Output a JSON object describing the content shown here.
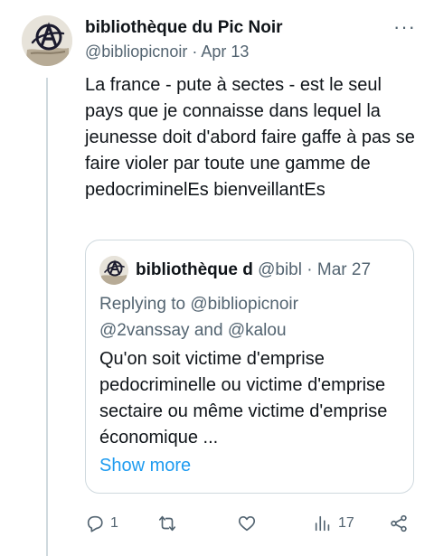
{
  "tweet": {
    "display_name": "bibliothèque du Pic Noir",
    "handle": "@bibliopicnoir",
    "separator": "·",
    "date": "Apr 13",
    "more_label": "···",
    "text": "La france - pute à sectes - est le seul pays que je connaisse dans lequel la jeunesse doit d'abord faire gaffe à pas se faire violer par toute une gamme de pedocriminelEs bienveillantEs"
  },
  "quote": {
    "display_name": "bibliothèque d",
    "handle": "@bibl",
    "separator": "·",
    "date": "Mar 27",
    "replying_prefix": "Replying to",
    "mention_1": "@bibliopicnoir",
    "mention_2": "@2vanssay",
    "and": "and",
    "mention_3": "@kalou",
    "text": "Qu'on soit victime d'emprise pedocriminelle ou victime d'emprise sectaire ou même victime d'emprise économique ...",
    "show_more": "Show more"
  },
  "actions": {
    "reply_count": "1",
    "views_count": "17"
  },
  "icons": [
    "reply-icon",
    "retweet-icon",
    "like-icon",
    "views-icon",
    "share-icon"
  ]
}
